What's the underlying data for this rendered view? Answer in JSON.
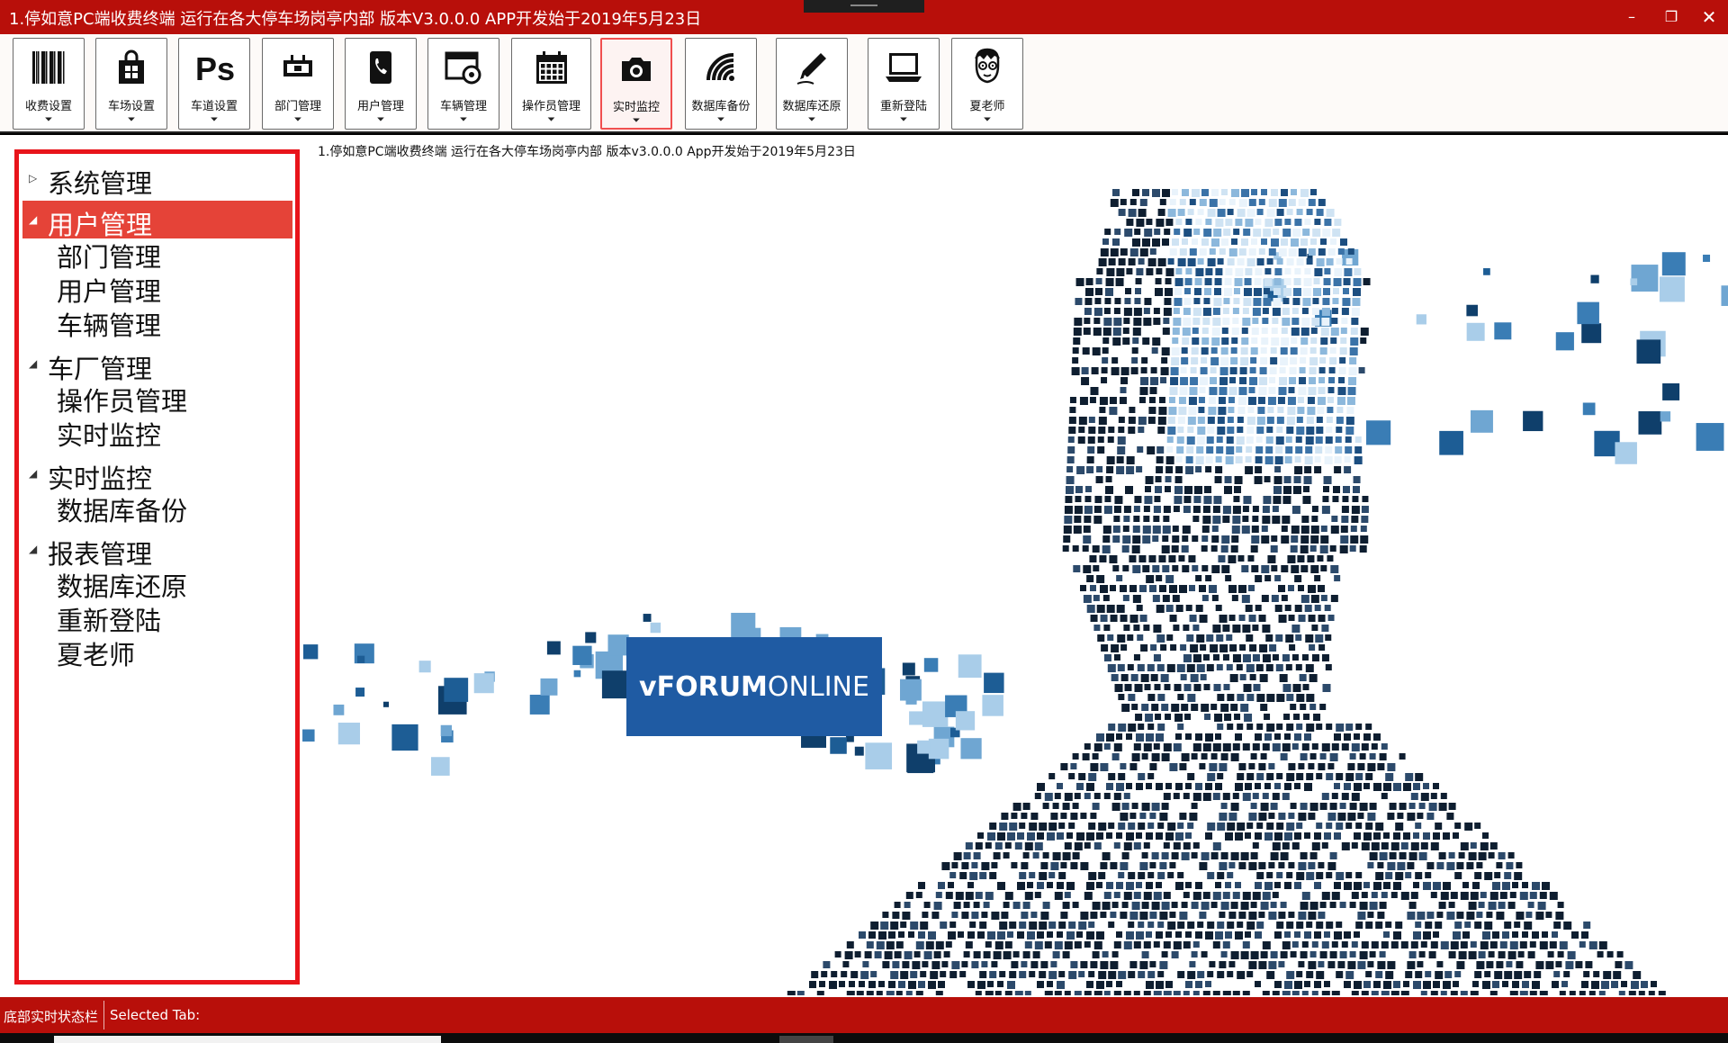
{
  "window": {
    "title": "1.停如意PC端收费终端 运行在各大停车场岗亭内部 版本V3.0.0.0 APP开发始于2019年5月23日",
    "minimize_icon": "minimize-icon",
    "restore_icon": "restore-icon",
    "close_icon": "close-icon"
  },
  "toolbar": {
    "buttons": [
      {
        "label": "收费设置",
        "icon": "barcode-icon"
      },
      {
        "label": "车场设置",
        "icon": "shop-bag-icon"
      },
      {
        "label": "车道设置",
        "icon": "ps-icon"
      },
      {
        "label": "部门管理",
        "icon": "plug-icon"
      },
      {
        "label": "用户管理",
        "icon": "phone-icon"
      },
      {
        "label": "车辆管理",
        "icon": "browser-icon"
      },
      {
        "label": "操作员管理",
        "icon": "calendar-icon"
      },
      {
        "label": "实时监控",
        "icon": "camera-icon"
      },
      {
        "label": "数据库备份",
        "icon": "wifi-icon"
      },
      {
        "label": "数据库还原",
        "icon": "pen-icon"
      },
      {
        "label": "重新登陆",
        "icon": "laptop-icon"
      },
      {
        "label": "夏老师",
        "icon": "face-icon"
      }
    ],
    "active_index": 7,
    "dropdown_glyph": "⌄"
  },
  "tree": {
    "groups": [
      {
        "label": "系统管理",
        "expanded": false,
        "selected": false,
        "children": []
      },
      {
        "label": "用户管理",
        "expanded": true,
        "selected": true,
        "children": [
          "部门管理",
          "用户管理",
          "车辆管理"
        ]
      },
      {
        "label": "车厂管理",
        "expanded": true,
        "selected": false,
        "children": [
          "操作员管理",
          "实时监控"
        ]
      },
      {
        "label": "实时监控",
        "expanded": true,
        "selected": false,
        "children": [
          "数据库备份"
        ]
      },
      {
        "label": "报表管理",
        "expanded": true,
        "selected": false,
        "children": [
          "数据库还原",
          "重新登陆",
          "夏老师"
        ]
      }
    ]
  },
  "content": {
    "caption": "1.停如意PC端收费终端 运行在各大停车场岗亭内部 版本v3.0.0.0 App开发始于2019年5月23日",
    "logo_bold": "vFORUM",
    "logo_light": "ONLINE"
  },
  "statusbar": {
    "left": "底部实时状态栏",
    "right": "Selected Tab:"
  },
  "colors": {
    "brand_red": "#b80f0a",
    "tree_border": "#e8141a",
    "tree_selected": "#e54338",
    "logo_blue": "#1f5ba3"
  }
}
